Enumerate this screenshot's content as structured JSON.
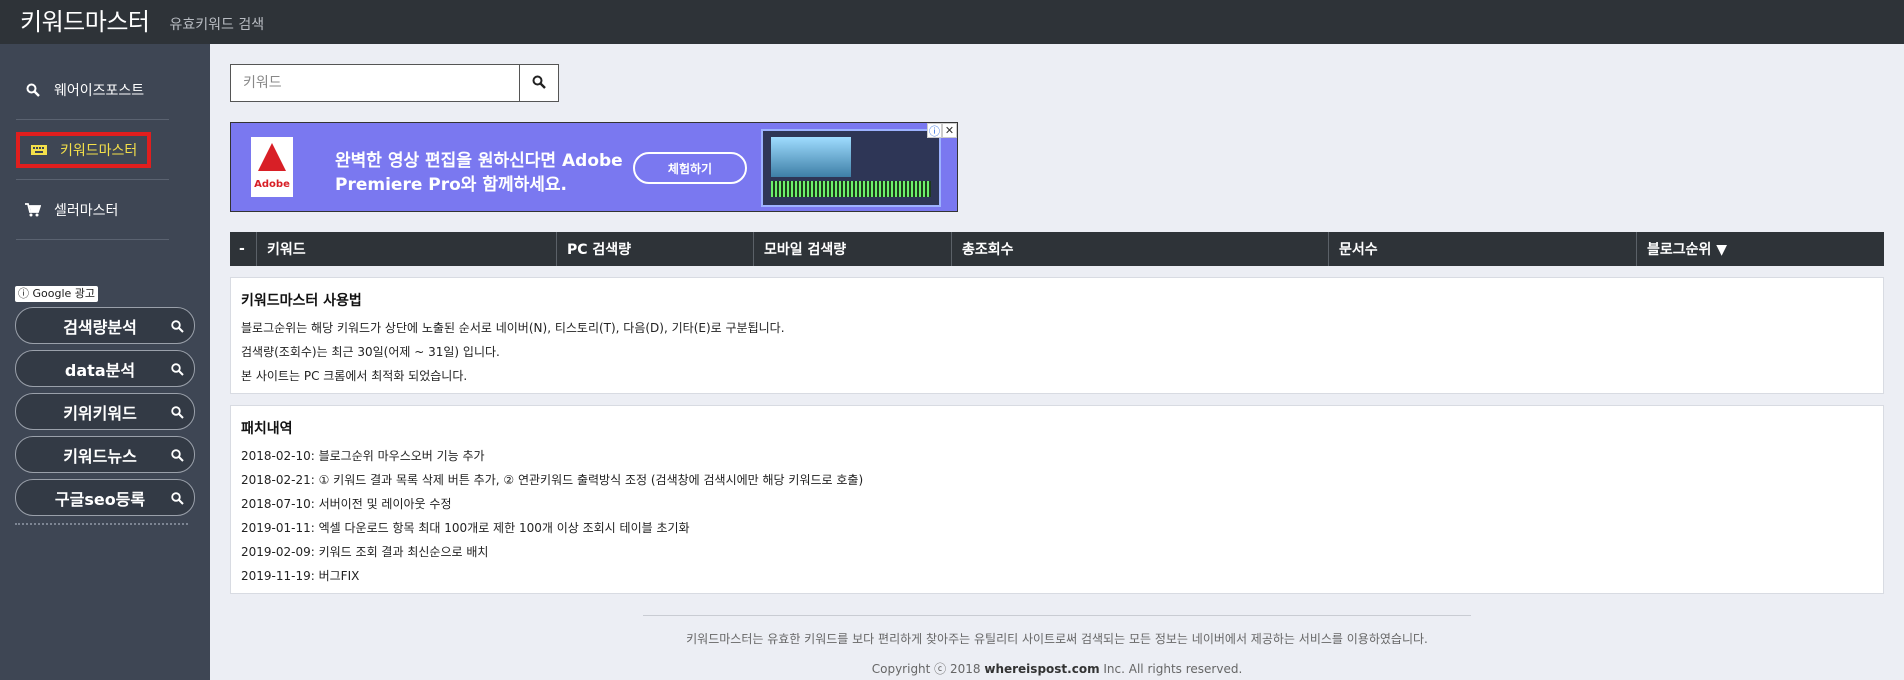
{
  "header": {
    "brand": "키워드마스터",
    "subtitle": "유효키워드 검색"
  },
  "sidebar": {
    "items": [
      {
        "label": "웨어이즈포스트",
        "icon": "search-icon",
        "active": false
      },
      {
        "label": "키워드마스터",
        "icon": "keyboard-icon",
        "active": true
      },
      {
        "label": "셀러마스터",
        "icon": "cart-icon",
        "active": false
      }
    ],
    "ad_label": "ⓘ Google 광고",
    "ad_buttons": [
      "검색량분석",
      "data분석",
      "키위키워드",
      "키워드뉴스",
      "구글seo등록"
    ]
  },
  "search": {
    "placeholder": "키워드",
    "value": ""
  },
  "banner": {
    "brand": "Adobe",
    "text": "완벽한 영상 편집을 원하신다면 Adobe Premiere Pro와 함께하세요.",
    "cta": "체험하기"
  },
  "table": {
    "columns": [
      "-",
      "키워드",
      "PC 검색량",
      "모바일 검색량",
      "총조회수",
      "문서수",
      "블로그순위 ▼"
    ]
  },
  "usage": {
    "title": "키워드마스터 사용법",
    "lines": [
      "블로그순위는 해당 키워드가 상단에 노출된 순서로 네이버(N), 티스토리(T), 다음(D), 기타(E)로 구분됩니다.",
      "검색량(조회수)는 최근 30일(어제 ~ 31일) 입니다.",
      "본 사이트는 PC 크롬에서 최적화 되었습니다."
    ]
  },
  "patch": {
    "title": "패치내역",
    "lines": [
      "2018-02-10: 블로그순위 마우스오버 기능 추가",
      "2018-02-21: ① 키워드 결과 목록 삭제 버튼 추가, ② 연관키워드 출력방식 조정 (검색창에 검색시에만 해당 키워드로 호출)",
      "2018-07-10: 서버이전 및 레이아웃 수정",
      "2019-01-11: 엑셀 다운로드 항목 최대 100개로 제한 100개 이상 조회시 테이블 초기화",
      "2019-02-09: 키워드 조회 결과 최신순으로 배치",
      "2019-11-19: 버그FIX"
    ]
  },
  "footer": {
    "notice": "키워드마스터는 유효한 키워드를 보다 편리하게 찾아주는 유틸리티 사이트로써 검색되는 모든 정보는 네이버에서 제공하는 서비스를 이용하였습니다.",
    "copyright_prefix": "Copyright ⓒ 2018 ",
    "copyright_domain": "whereispost.com",
    "copyright_suffix": " Inc. All rights reserved."
  }
}
